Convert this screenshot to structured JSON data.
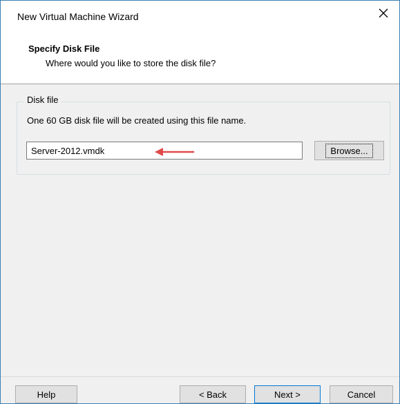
{
  "window": {
    "title": "New Virtual Machine Wizard",
    "close_glyph": "✕"
  },
  "header": {
    "title": "Specify Disk File",
    "subtitle": "Where would you like to store the disk file?"
  },
  "disk_group": {
    "legend": "Disk file",
    "description": "One 60 GB disk file will be created using this file name.",
    "filename_value": "Server-2012.vmdk",
    "browse_label": "Browse...",
    "arrow_color": "#e04a4a"
  },
  "footer": {
    "help_label": "Help",
    "back_label": "< Back",
    "next_label": "Next >",
    "cancel_label": "Cancel"
  },
  "colors": {
    "accent": "#0078d7",
    "window_border": "#3c7fb1",
    "panel_bg": "#f0f0f0"
  }
}
